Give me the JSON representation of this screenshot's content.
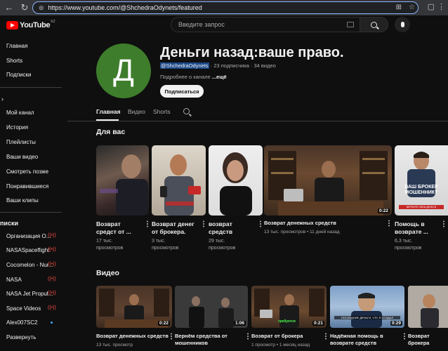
{
  "browser": {
    "url": "https://www.youtube.com/@ShchedraOdynets/featured"
  },
  "masthead": {
    "logo_text": "YouTube",
    "region": "KZ",
    "search_placeholder": "Введите запрос"
  },
  "sidebar": {
    "primary": [
      "Главная",
      "Shorts",
      "Подписки"
    ],
    "you": [
      "Мой канал",
      "История",
      "Плейлисты",
      "Ваши видео",
      "Смотреть позже",
      "Понравившиеся",
      "Ваши клипы"
    ],
    "subscriptions_heading": "писки",
    "subscriptions": [
      "Организация О...",
      "NASASpaceflight",
      "Cocomelon - Nur...",
      "NASA",
      "NASA Jet Propul...",
      "Space Videos",
      "Alex007SC2",
      "Развернуть"
    ]
  },
  "channel": {
    "avatar_letter": "Д",
    "title": "Деньги назад:ваше право.",
    "handle": "@ShchedraOdynets",
    "stats": " · 23 подписчика · 34 видео",
    "desc_prefix": "Подробнее о канале ",
    "desc_more": "...ещё",
    "subscribe_label": "Подписаться"
  },
  "tabs": [
    "Главная",
    "Видео",
    "Shorts"
  ],
  "sections": {
    "for_you": "Для вас",
    "videos": "Видео"
  },
  "for_you": {
    "shorts": [
      {
        "title_1": "Возврат",
        "title_2": "средст от ...",
        "views_1": "17 тыс.",
        "views_2": "просмотров"
      },
      {
        "title_1": "Возврат денег",
        "title_2": "от брокера.",
        "views_1": "3 тыс.",
        "views_2": "просмотров"
      },
      {
        "title_1": "возврат",
        "title_2": "средств",
        "views_1": "29 тыс.",
        "views_2": "просмотров"
      }
    ],
    "featured": {
      "title": "Возврат денежных средств",
      "meta": "13 тыс. просмотров • 11 дней назад",
      "duration": "0:22"
    },
    "last_short": {
      "title_1": "Помощь в",
      "title_2": "возврате ...",
      "views_1": "6,3 тыс.",
      "views_2": "просмотров",
      "overlay_1": "ВАШ БРОКЕР",
      "overlay_2": "МОШЕННИК?",
      "overlay_btn": "ВЕРНИТЕ СВОИ ДЕНЬГИ"
    }
  },
  "videos": [
    {
      "title_1": "Возврат денежных средств",
      "title_2": "",
      "meta": "13 тыс. просмотр",
      "duration": "0:22"
    },
    {
      "title_1": "Вернём средства от",
      "title_2": "мошенников",
      "meta": "",
      "duration": "1:06"
    },
    {
      "title_1": "Возврат от брокера",
      "title_2": "",
      "meta": "1 просмотр • 1 месяц назад",
      "duration": "0:21",
      "caption": "требуется"
    },
    {
      "title_1": "Надёжная помощь в",
      "title_2": "возврате средств",
      "meta": "",
      "duration": "0:29",
      "caption": "ПОСЛЕДНИЕ ДЕНЬГИ, ЧТО Я СОЗДАЛ"
    },
    {
      "title_1": "Возврат",
      "title_2": "брокера",
      "meta": "",
      "duration": ""
    }
  ],
  "tab_underline_hint": "Главная"
}
